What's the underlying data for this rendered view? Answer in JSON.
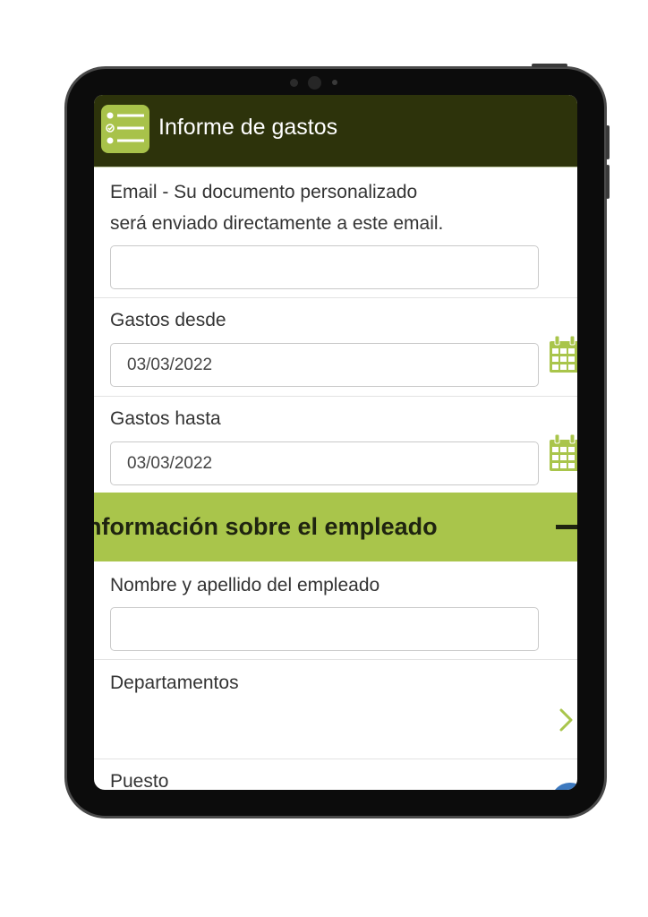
{
  "app": {
    "title": "Informe de gastos",
    "icon": "checklist-icon",
    "header_color": "#2d330b",
    "accent_color": "#a9c54b"
  },
  "form": {
    "email": {
      "label_line1": "Email - Su documento personalizado",
      "label_line2": "será enviado directamente a este email.",
      "value": ""
    },
    "gastos_desde": {
      "label": "Gastos desde",
      "value": "03/03/2022",
      "icon": "calendar-icon"
    },
    "gastos_hasta": {
      "label": "Gastos hasta",
      "value": "03/03/2022",
      "icon": "calendar-icon"
    },
    "section_empleado": {
      "title": "nformación sobre el empleado",
      "toggle_icon": "collapse-minus-icon"
    },
    "nombre": {
      "label": "Nombre y apellido del empleado",
      "value": ""
    },
    "departamentos": {
      "label": "Departamentos",
      "icon": "chevron-right-icon"
    },
    "puesto": {
      "label": "Puesto"
    }
  }
}
